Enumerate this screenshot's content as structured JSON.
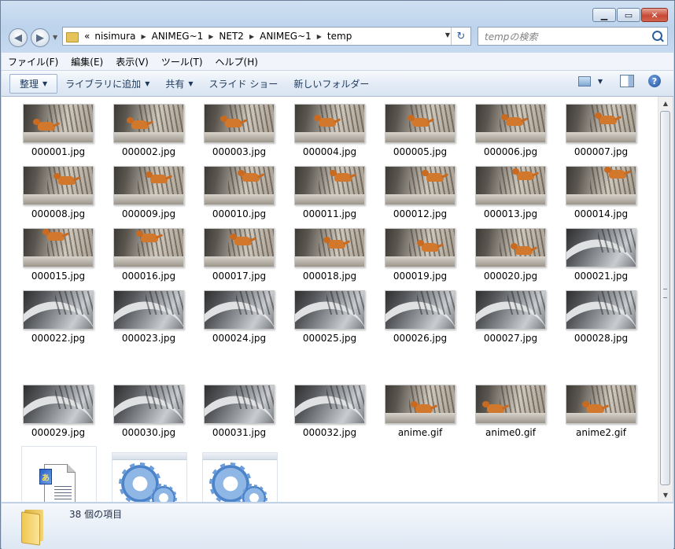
{
  "address": {
    "overflow_glyph": "«",
    "crumbs": [
      "nisimura",
      "ANIMEG~1",
      "NET2",
      "ANIMEG~1",
      "temp"
    ]
  },
  "search": {
    "placeholder": "tempの検索"
  },
  "menu": [
    "ファイル(F)",
    "編集(E)",
    "表示(V)",
    "ツール(T)",
    "ヘルプ(H)"
  ],
  "toolbar": {
    "organize": "整理",
    "library": "ライブラリに追加",
    "share": "共有",
    "slideshow": "スライド ショー",
    "new_folder": "新しいフォルダー"
  },
  "files": [
    "000001.jpg",
    "000002.jpg",
    "000003.jpg",
    "000004.jpg",
    "000005.jpg",
    "000006.jpg",
    "000007.jpg",
    "000008.jpg",
    "000009.jpg",
    "000010.jpg",
    "000011.jpg",
    "000012.jpg",
    "000013.jpg",
    "000014.jpg",
    "000015.jpg",
    "000016.jpg",
    "000017.jpg",
    "000018.jpg",
    "000019.jpg",
    "000020.jpg",
    "000021.jpg",
    "000022.jpg",
    "000023.jpg",
    "000024.jpg",
    "000025.jpg",
    "000026.jpg",
    "000027.jpg",
    "000028.jpg",
    "000029.jpg",
    "000030.jpg",
    "000031.jpg",
    "000032.jpg",
    "anime.gif",
    "anime0.gif",
    "anime2.gif"
  ],
  "status": {
    "item_count": "38 個の項目"
  },
  "icons": {
    "back": "back-arrow-icon",
    "forward": "forward-arrow-icon",
    "refresh": "refresh-icon",
    "search": "search-icon",
    "help": "help-icon"
  }
}
